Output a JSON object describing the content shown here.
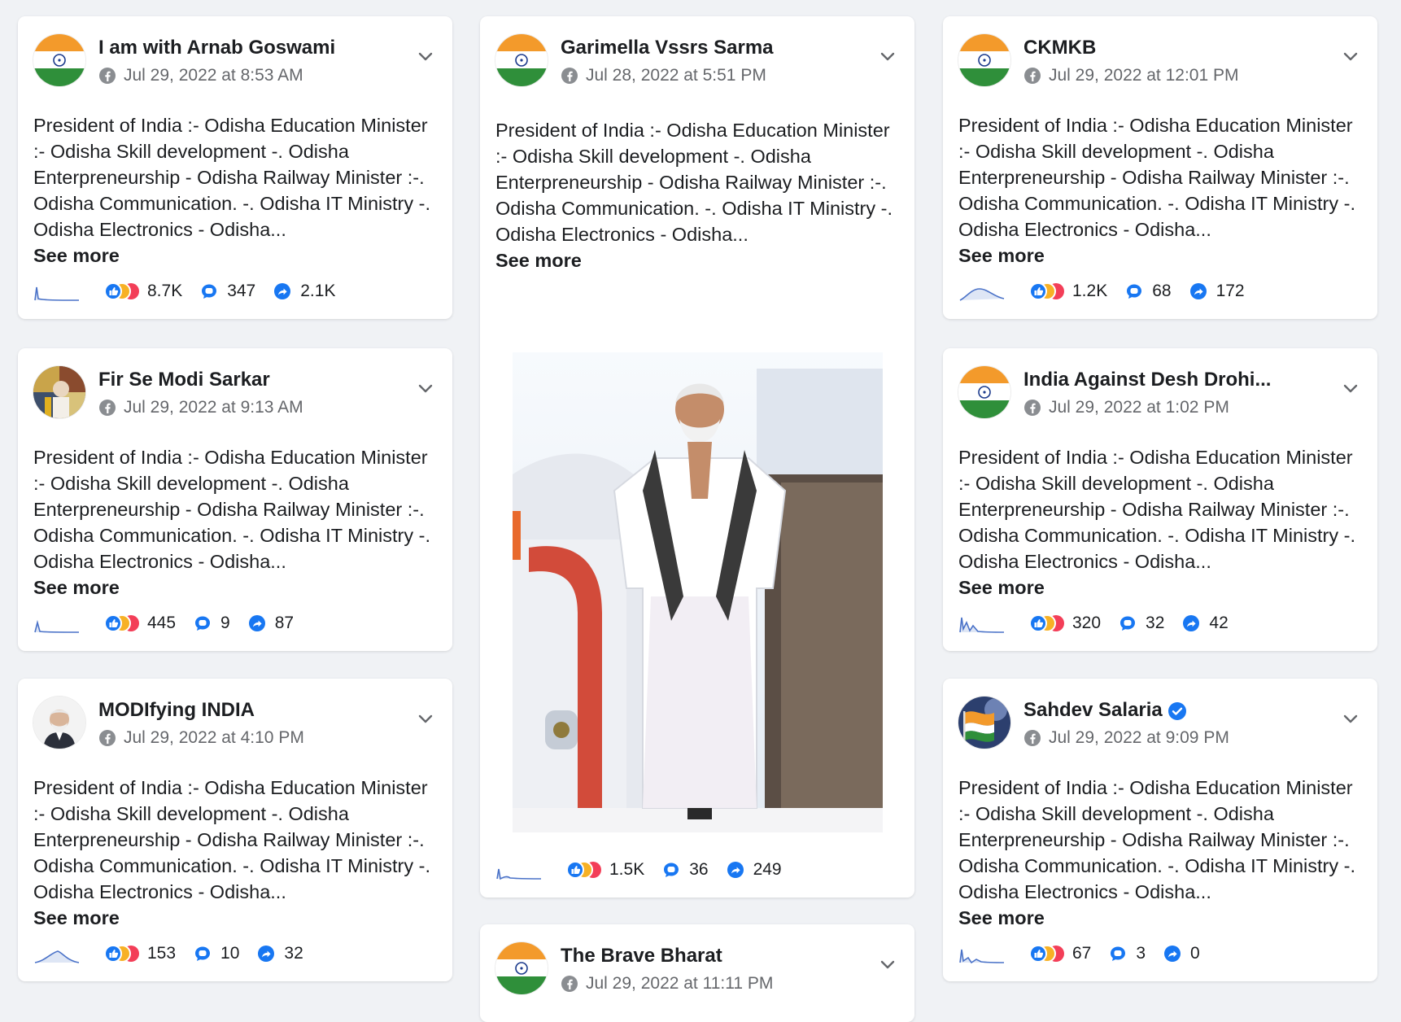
{
  "colors": {
    "page_bg": "#f0f2f5",
    "card_bg": "#ffffff",
    "meta_text": "#65676b",
    "accent_blue": "#1877f2",
    "sparkline": "#4a72c8"
  },
  "posts": [
    {
      "author": "I am with Arnab Goswami",
      "timestamp": "Jul 29, 2022 at 8:53 AM",
      "avatar": "india-flag",
      "text": "President of India :- Odisha Education Minister :- Odisha Skill development -. Odisha Enterpreneurship - Odisha Railway Minister :-. Odisha Communication. -. Odisha IT Ministry -. Odisha Electronics - Odisha...",
      "see_more": "See more",
      "reactions": "8.7K",
      "comments": "347",
      "shares": "2.1K"
    },
    {
      "author": "Fir Se Modi Sarkar",
      "timestamp": "Jul 29, 2022 at 9:13 AM",
      "avatar": "collage",
      "text": "President of India :- Odisha Education Minister :- Odisha Skill development -. Odisha Enterpreneurship - Odisha Railway Minister :-. Odisha Communication. -. Odisha IT Ministry -. Odisha Electronics - Odisha...",
      "see_more": "See more",
      "reactions": "445",
      "comments": "9",
      "shares": "87"
    },
    {
      "author": "MODIfying INDIA",
      "timestamp": "Jul 29, 2022 at 4:10 PM",
      "avatar": "portrait",
      "text": "President of India :- Odisha Education Minister :- Odisha Skill development -. Odisha Enterpreneurship - Odisha Railway Minister :-. Odisha Communication. -. Odisha IT Ministry -. Odisha Electronics - Odisha...",
      "see_more": "See more",
      "reactions": "153",
      "comments": "10",
      "shares": "32"
    },
    {
      "author": "Garimella Vssrs Sarma",
      "timestamp": "Jul 28, 2022 at 5:51 PM",
      "avatar": "india-flag",
      "text": "President of India :- Odisha Education Minister :- Odisha Skill development -. Odisha Enterpreneurship - Odisha Railway Minister :-. Odisha Communication. -. Odisha IT Ministry -. Odisha Electronics - Odisha...",
      "see_more": "See more",
      "reactions": "1.5K",
      "comments": "36",
      "shares": "249",
      "image": "man-in-white-at-aircraft-door"
    },
    {
      "author": "The Brave Bharat",
      "timestamp": "Jul 29, 2022 at 11:11 PM",
      "avatar": "india-flag"
    },
    {
      "author": "CKMKB",
      "timestamp": "Jul 29, 2022 at 12:01 PM",
      "avatar": "india-flag",
      "text": "President of India :- Odisha Education Minister :- Odisha Skill development -. Odisha Enterpreneurship - Odisha Railway Minister :-. Odisha Communication. -. Odisha IT Ministry -. Odisha Electronics - Odisha...",
      "see_more": "See more",
      "reactions": "1.2K",
      "comments": "68",
      "shares": "172"
    },
    {
      "author": "India Against Desh Drohi...",
      "timestamp": "Jul 29, 2022 at 1:02 PM",
      "avatar": "india-flag",
      "text": "President of India :- Odisha Education Minister :- Odisha Skill development -. Odisha Enterpreneurship - Odisha Railway Minister :-. Odisha Communication. -. Odisha IT Ministry -. Odisha Electronics - Odisha...",
      "see_more": "See more",
      "reactions": "320",
      "comments": "32",
      "shares": "42"
    },
    {
      "author": "Sahdev Salaria",
      "verified": true,
      "timestamp": "Jul 29, 2022 at 9:09 PM",
      "avatar": "flag-sky",
      "text": "President of India :- Odisha Education Minister :- Odisha Skill development -. Odisha Enterpreneurship - Odisha Railway Minister :-. Odisha Communication. -. Odisha IT Ministry -. Odisha Electronics - Odisha...",
      "see_more": "See more",
      "reactions": "67",
      "comments": "3",
      "shares": "0"
    }
  ]
}
